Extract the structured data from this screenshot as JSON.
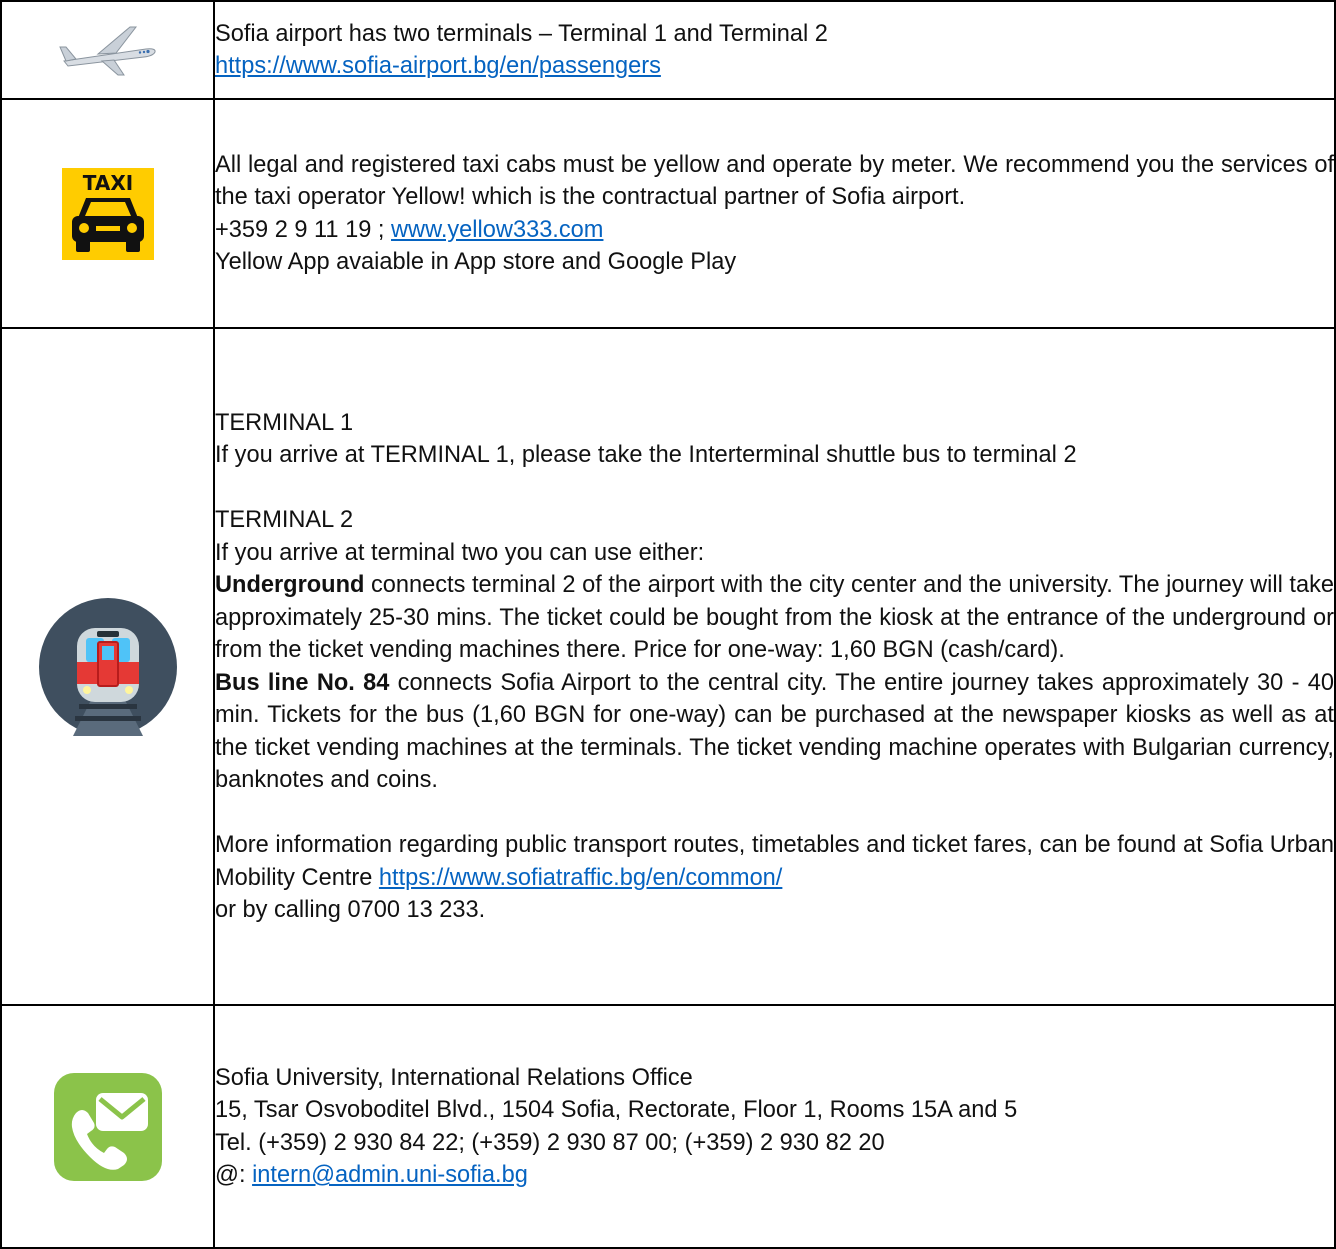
{
  "rows": {
    "airport": {
      "icon": "airplane-icon",
      "line1": "Sofia airport has two terminals – Terminal 1 and Terminal 2",
      "link": "https://www.sofia-airport.bg/en/passengers"
    },
    "taxi": {
      "icon": "taxi-icon",
      "icon_text": "TAXI",
      "intro": "All legal and registered taxi cabs must be yellow and operate by meter. We recommend you the services of the taxi operator Yellow! which is the contractual partner of Sofia airport.",
      "phone": "+359 2 9 11 19 ; ",
      "link": "www.yellow333.com",
      "app": "Yellow App avaiable in App store and Google Play"
    },
    "transport": {
      "icon": "metro-train-icon",
      "t1_heading": "TERMINAL 1",
      "t1_text": "If you arrive at TERMINAL 1, please take the Interterminal shuttle bus to terminal 2",
      "t2_heading": "TERMINAL 2",
      "t2_text": "If you arrive at terminal two you can use either:",
      "underground_bold": "Underground",
      "underground_text": " connects terminal 2 of the airport with the city center and the university. The journey will take approximately 25-30 mins. The ticket could be bought from the kiosk at the entrance of the underground or from the ticket vending machines there. Price for one-way: 1,60 BGN (cash/card).",
      "bus_bold": "Bus line No. 84",
      "bus_text": " connects Sofia Airport to the central city. The entire journey takes approximately 30 - 40 min. Tickets for the bus (1,60 BGN for one-way) can be purchased at the newspaper kiosks as well as at the ticket vending machines at the terminals. The ticket vending machine operates with Bulgarian currency, banknotes and coins.",
      "more_info": "More information regarding public transport routes, timetables and ticket fares, can be found at Sofia Urban Mobility Centre ",
      "more_link": "https://www.sofiatraffic.bg/en/common/",
      "more_tail": "or by calling 0700 13 233."
    },
    "contact": {
      "icon": "phone-mail-icon",
      "office": "Sofia University, International Relations Office",
      "address": "15, Tsar Osvoboditel Blvd., 1504 Sofia, Rectorate, Floor 1, Rooms 15A and 5",
      "tel": "Tel. (+359) 2 930 84 22;  (+359) 2 930 87 00; (+359) 2 930 82 20",
      "email_prefix": "@: ",
      "email": "intern@admin.uni-sofia.bg"
    }
  },
  "colors": {
    "link": "#0563c1",
    "taxi_yellow": "#ffcc00",
    "phone_green": "#8bc34a",
    "metro_red": "#e53935",
    "metro_bg": "#3f4f5f"
  }
}
